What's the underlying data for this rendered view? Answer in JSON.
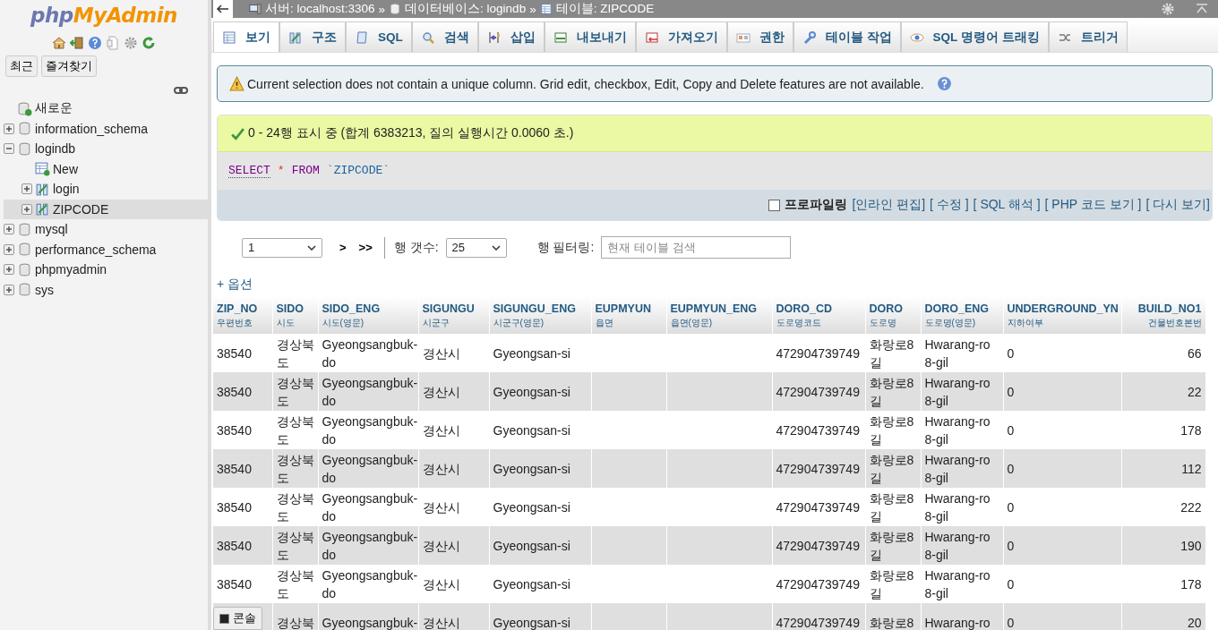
{
  "sidebar": {
    "logo": {
      "part_1": "php",
      "part_2": "MyAdmin"
    },
    "buttons": [
      "최근",
      "즐겨찾기"
    ],
    "tree": [
      {
        "label": "새로운",
        "kind": "new",
        "selected": false
      },
      {
        "label": "information_schema",
        "kind": "db",
        "expanded": false,
        "selected": false
      },
      {
        "label": "logindb",
        "kind": "db",
        "expanded": true,
        "selected": false,
        "children": [
          {
            "label": "New",
            "kind": "new_table",
            "selected": false
          },
          {
            "label": "login",
            "kind": "table",
            "expanded": false,
            "selected": false
          },
          {
            "label": "ZIPCODE",
            "kind": "table",
            "expanded": false,
            "selected": true
          }
        ]
      },
      {
        "label": "mysql",
        "kind": "db",
        "expanded": false,
        "selected": false
      },
      {
        "label": "performance_schema",
        "kind": "db",
        "expanded": false,
        "selected": false
      },
      {
        "label": "phpmyadmin",
        "kind": "db",
        "expanded": false,
        "selected": false
      },
      {
        "label": "sys",
        "kind": "db",
        "expanded": false,
        "selected": false
      }
    ]
  },
  "breadcrumb": [
    {
      "kind": "server",
      "text": "서버: localhost:3306"
    },
    {
      "kind": "sep",
      "text": "»"
    },
    {
      "kind": "database",
      "text": "데이터베이스: logindb"
    },
    {
      "kind": "sep",
      "text": "»"
    },
    {
      "kind": "table",
      "text": "테이블: ZIPCODE"
    }
  ],
  "tabs": [
    {
      "label": "보기",
      "selected": true
    },
    {
      "label": "구조",
      "selected": false
    },
    {
      "label": "SQL",
      "selected": false
    },
    {
      "label": "검색",
      "selected": false
    },
    {
      "label": "삽입",
      "selected": false
    },
    {
      "label": "내보내기",
      "selected": false
    },
    {
      "label": "가져오기",
      "selected": false
    },
    {
      "label": "권한",
      "selected": false
    },
    {
      "label": "테이블 작업",
      "selected": false
    },
    {
      "label": "SQL 명령어 트래킹",
      "selected": false
    },
    {
      "label": "트리거",
      "selected": false
    }
  ],
  "notice": "Current selection does not contain a unique column. Grid edit, checkbox, Edit, Copy and Delete features are not available.",
  "result": {
    "message": "0 - 24행 표시 중 (합계 6383213, 질의 실행시간 0.0060 초.)",
    "sql": [
      {
        "kind": "keyword",
        "text": "SELECT"
      },
      {
        "kind": "operator",
        "text": "*"
      },
      {
        "kind": "keyword",
        "text": "FROM"
      },
      {
        "kind": "identifier",
        "text": "`ZIPCODE`"
      }
    ],
    "profiling": {
      "label": "프로파일링",
      "checked": false
    },
    "links": [
      "[인라인 편집]",
      "[ 수정 ]",
      "[ SQL 해석 ]",
      "[ PHP 코드 보기 ]",
      "[ 다시 보기]"
    ]
  },
  "navigation": {
    "page": "1",
    "next": ">",
    "last": ">>",
    "rows_label": "행 갯수:",
    "rows": "25",
    "filter_label": "행 필터링:",
    "filter_placeholder": "현재 테이블 검색"
  },
  "options_link": "+ 옵션",
  "table": {
    "columns": [
      {
        "name": "ZIP_NO",
        "comment": "우편번호"
      },
      {
        "name": "SIDO",
        "comment": "시도"
      },
      {
        "name": "SIDO_ENG",
        "comment": "시도(영문)"
      },
      {
        "name": "SIGUNGU",
        "comment": "시군구"
      },
      {
        "name": "SIGUNGU_ENG",
        "comment": "시군구(영문)"
      },
      {
        "name": "EUPMYUN",
        "comment": "읍면"
      },
      {
        "name": "EUPMYUN_ENG",
        "comment": "읍면(영문)"
      },
      {
        "name": "DORO_CD",
        "comment": "도로명코드"
      },
      {
        "name": "DORO",
        "comment": "도로명"
      },
      {
        "name": "DORO_ENG",
        "comment": "도로명(영문)"
      },
      {
        "name": "UNDERGROUND_YN",
        "comment": "지하여부"
      },
      {
        "name": "BUILD_NO1",
        "comment": "건물번호본번"
      }
    ],
    "rows": [
      [
        "38540",
        "경상북도",
        "Gyeongsangbuk-do",
        "경산시",
        "Gyeongsan-si",
        null,
        null,
        "472904739749",
        "화랑로8길",
        "Hwarang-ro 8-gil",
        "0",
        "66"
      ],
      [
        "38540",
        "경상북도",
        "Gyeongsangbuk-do",
        "경산시",
        "Gyeongsan-si",
        null,
        null,
        "472904739749",
        "화랑로8길",
        "Hwarang-ro 8-gil",
        "0",
        "22"
      ],
      [
        "38540",
        "경상북도",
        "Gyeongsangbuk-do",
        "경산시",
        "Gyeongsan-si",
        null,
        null,
        "472904739749",
        "화랑로8길",
        "Hwarang-ro 8-gil",
        "0",
        "178"
      ],
      [
        "38540",
        "경상북도",
        "Gyeongsangbuk-do",
        "경산시",
        "Gyeongsan-si",
        null,
        null,
        "472904739749",
        "화랑로8길",
        "Hwarang-ro 8-gil",
        "0",
        "112"
      ],
      [
        "38540",
        "경상북도",
        "Gyeongsangbuk-do",
        "경산시",
        "Gyeongsan-si",
        null,
        null,
        "472904739749",
        "화랑로8길",
        "Hwarang-ro 8-gil",
        "0",
        "222"
      ],
      [
        "38540",
        "경상북도",
        "Gyeongsangbuk-do",
        "경산시",
        "Gyeongsan-si",
        null,
        null,
        "472904739749",
        "화랑로8길",
        "Hwarang-ro 8-gil",
        "0",
        "190"
      ],
      [
        "38540",
        "경상북도",
        "Gyeongsangbuk-do",
        "경산시",
        "Gyeongsan-si",
        null,
        null,
        "472904739749",
        "화랑로8길",
        "Hwarang-ro 8-gil",
        "0",
        "178"
      ],
      [
        null,
        "경상북",
        "Gyeongsangbuk-",
        "경산시",
        "Gyeongsan-si",
        null,
        null,
        "472904739749",
        "화랑로8",
        "Hwarang-ro",
        "0",
        "20"
      ]
    ]
  },
  "console_button": "콘솔"
}
